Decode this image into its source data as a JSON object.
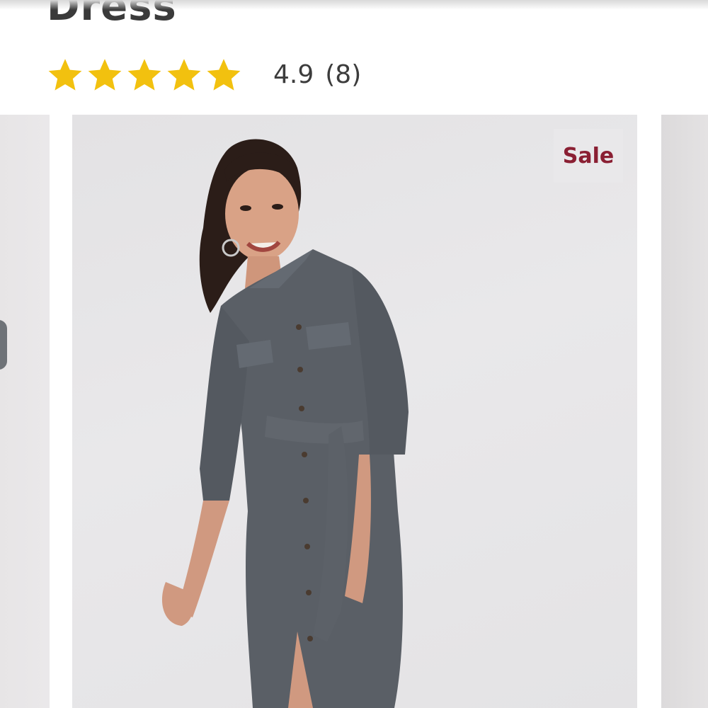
{
  "product": {
    "title": "Dress"
  },
  "rating": {
    "value": "4.9",
    "count": "(8)",
    "stars_filled": 5,
    "stars_total": 5,
    "star_color": "#f2c10f"
  },
  "carousel": {
    "badge": "Sale",
    "badge_color": "#8a1f33",
    "image_icon": "model-shirt-dress-photo"
  }
}
